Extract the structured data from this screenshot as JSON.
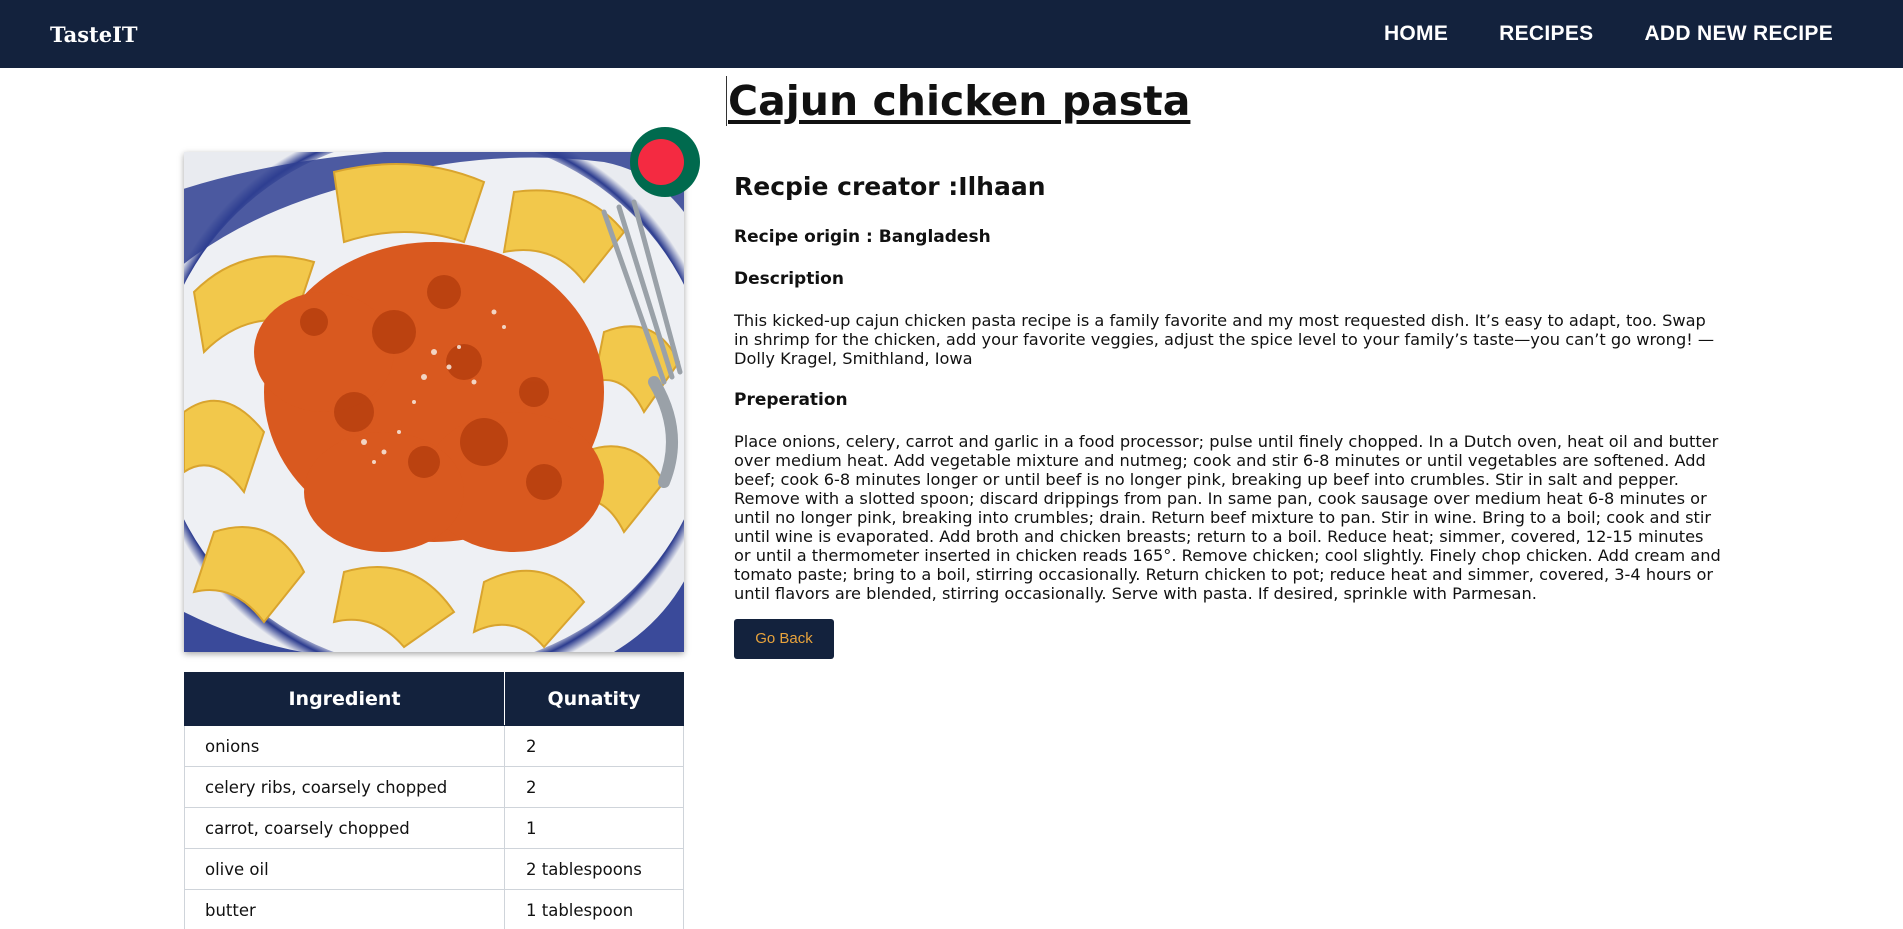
{
  "nav": {
    "brand": "TasteIT",
    "links": [
      "HOME",
      "RECIPES",
      "ADD NEW RECIPE"
    ]
  },
  "recipe": {
    "title": "Cajun chicken pasta",
    "creator": "Recpie creator :Ilhaan",
    "origin": "Recipe origin : Bangladesh",
    "description_heading": "Description",
    "description": "This kicked-up cajun chicken pasta recipe is a family favorite and my most requested dish. It’s easy to adapt, too. Swap in shrimp for the chicken, add your favorite veggies, adjust the spice level to your family’s taste—you can’t go wrong! —Dolly Kragel, Smithland, Iowa",
    "preparation_heading": "Preperation",
    "preparation": "Place onions, celery, carrot and garlic in a food processor; pulse until finely chopped. In a Dutch oven, heat oil and butter over medium heat. Add vegetable mixture and nutmeg; cook and stir 6-8 minutes or until vegetables are softened. Add beef; cook 6-8 minutes longer or until beef is no longer pink, breaking up beef into crumbles. Stir in salt and pepper. Remove with a slotted spoon; discard drippings from pan. In same pan, cook sausage over medium heat 6-8 minutes or until no longer pink, breaking into crumbles; drain. Return beef mixture to pan. Stir in wine. Bring to a boil; cook and stir until wine is evaporated. Add broth and chicken breasts; return to a boil. Reduce heat; simmer, covered, 12-15 minutes or until a thermometer inserted in chicken reads 165°. Remove chicken; cool slightly. Finely chop chicken. Add cream and tomato paste; bring to a boil, stirring occasionally. Return chicken to pot; reduce heat and simmer, covered, 3-4 hours or until flavors are blended, stirring occasionally. Serve with pasta. If desired, sprinkle with Parmesan.",
    "back_button": "Go Back",
    "flag_colors": {
      "field": "#006a4e",
      "disc": "#f42a41"
    }
  },
  "table": {
    "headers": [
      "Ingredient",
      "Qunatity"
    ],
    "rows": [
      [
        "onions",
        "2"
      ],
      [
        "celery ribs, coarsely chopped",
        "2"
      ],
      [
        "carrot, coarsely chopped",
        "1"
      ],
      [
        "olive oil",
        "2 tablespoons"
      ],
      [
        "butter",
        "1 tablespoon"
      ]
    ]
  },
  "colors": {
    "nav": "#13223d",
    "button_text": "#e8a33c"
  }
}
